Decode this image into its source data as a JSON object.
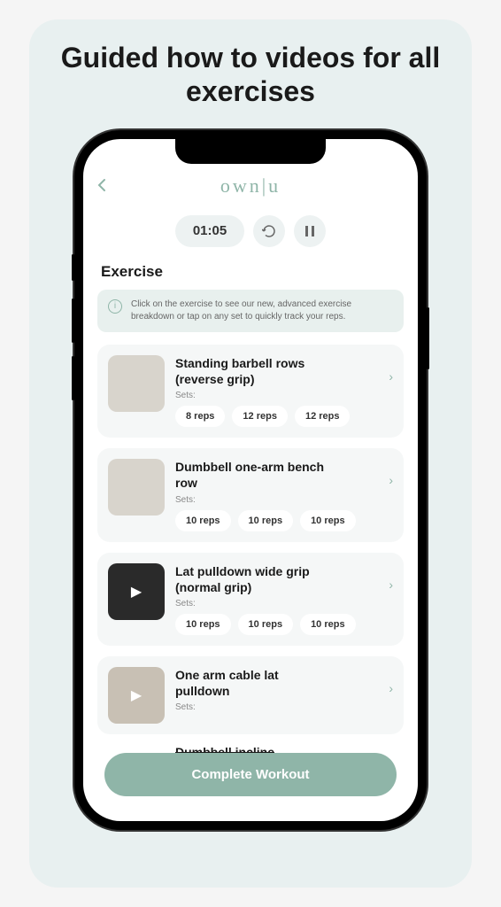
{
  "promo": {
    "title": "Guided how to videos for all exercises"
  },
  "header": {
    "logo": "own|u"
  },
  "timer": {
    "value": "01:05"
  },
  "section": {
    "title": "Exercise"
  },
  "info": {
    "text": "Click on the exercise to see our new, advanced exercise breakdown or tap on any set to quickly track your reps."
  },
  "exercises": [
    {
      "name": "Standing barbell rows (reverse grip)",
      "sets_label": "Sets:",
      "reps": [
        "8 reps",
        "12 reps",
        "12 reps"
      ]
    },
    {
      "name": "Dumbbell one-arm bench row",
      "sets_label": "Sets:",
      "reps": [
        "10 reps",
        "10 reps",
        "10 reps"
      ]
    },
    {
      "name": "Lat pulldown wide grip (normal grip)",
      "sets_label": "Sets:",
      "reps": [
        "10 reps",
        "10 reps",
        "10 reps"
      ]
    },
    {
      "name": "One arm cable lat pulldown",
      "sets_label": "Sets:",
      "reps": []
    },
    {
      "name": "Dumbbell incline",
      "sets_label": "",
      "reps": []
    }
  ],
  "cta": {
    "label": "Complete Workout"
  }
}
